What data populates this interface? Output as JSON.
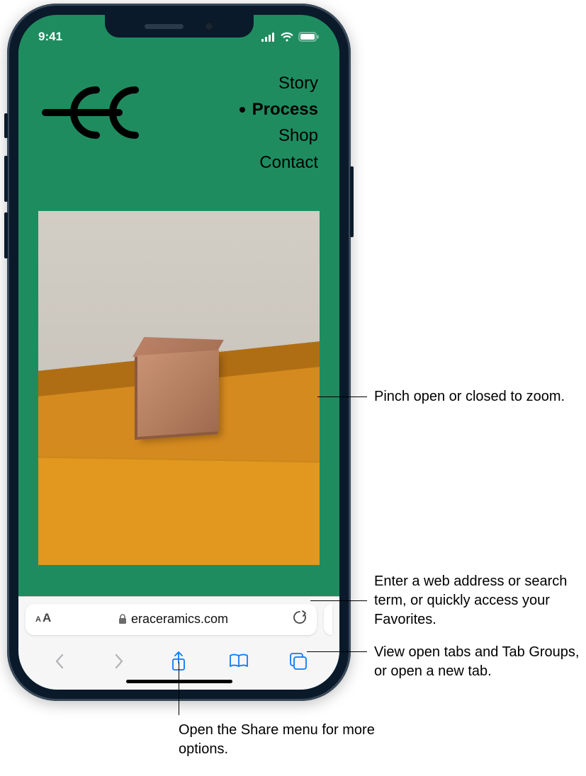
{
  "status": {
    "time": "9:41",
    "signal_icon": "cellular-icon",
    "wifi_icon": "wifi-icon",
    "battery_icon": "battery-icon"
  },
  "site": {
    "nav": [
      {
        "label": "Story",
        "active": false
      },
      {
        "label": "Process",
        "active": true
      },
      {
        "label": "Shop",
        "active": false
      },
      {
        "label": "Contact",
        "active": false
      }
    ]
  },
  "address_bar": {
    "reader_icon": "text-size-icon",
    "lock_icon": "lock-icon",
    "url": "eraceramics.com",
    "reload_icon": "reload-icon"
  },
  "toolbar": {
    "back": "chevron-left-icon",
    "forward": "chevron-right-icon",
    "share": "share-icon",
    "bookmarks": "book-icon",
    "tabs": "tabs-icon"
  },
  "callouts": {
    "pinch": "Pinch open or closed to zoom.",
    "address": "Enter a web address or search term, or quickly access your Favorites.",
    "tabs": "View open tabs and Tab Groups, or open a new tab.",
    "share": "Open the Share menu for more options."
  }
}
